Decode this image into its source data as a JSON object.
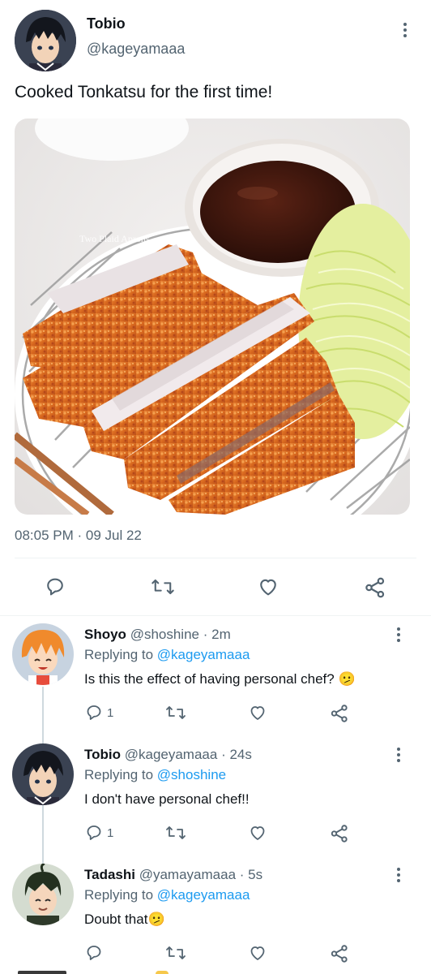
{
  "main_tweet": {
    "display_name": "Tobio",
    "handle": "@kageyamaaa",
    "text": "Cooked Tonkatsu for the first time!",
    "image_watermark": "Two Plaid Aprons",
    "timestamp": "08:05 PM · 09 Jul 22",
    "icons": [
      "avatar",
      "more-dots-icon",
      "reply-icon",
      "retweet-icon",
      "like-icon",
      "share-icon"
    ]
  },
  "replies": [
    {
      "display_name": "Shoyo",
      "handle": "@shoshine",
      "time": "· 2m",
      "replying_label": "Replying to",
      "replying_to": "@kageyamaaa",
      "text": "Is this the effect of having personal chef?",
      "emoji": "🫤",
      "reply_count": "1"
    },
    {
      "display_name": "Tobio",
      "handle": "@kageyamaaa",
      "time": "· 24s",
      "replying_label": "Replying to",
      "replying_to": "@shoshine",
      "text": "I don't have personal chef!!",
      "emoji": "",
      "reply_count": "1"
    },
    {
      "display_name": "Tadashi",
      "handle": "@yamayamaaa",
      "time": "· 5s",
      "replying_label": "Replying to",
      "replying_to": "@kageyamaaa",
      "text": "Doubt that",
      "emoji": "🫤",
      "reply_count": ""
    }
  ],
  "colors": {
    "text": "#0f1419",
    "muted": "#536471",
    "link": "#1d9bf0",
    "divider": "#eff3f4"
  }
}
